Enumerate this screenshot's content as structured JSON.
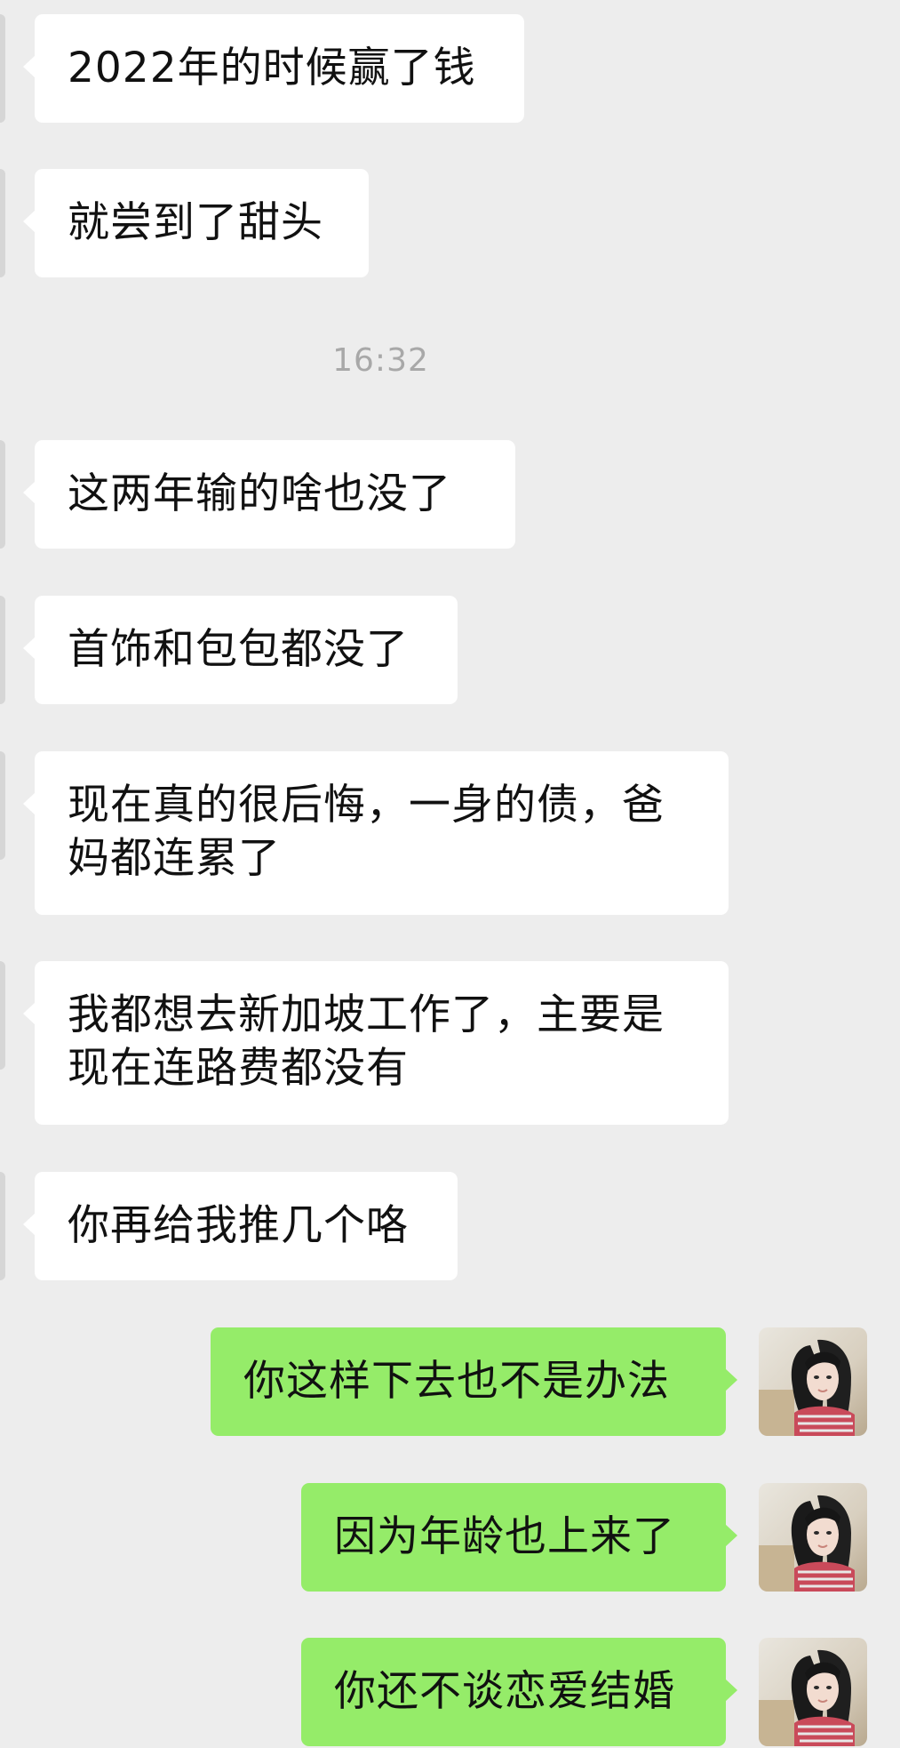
{
  "timestamp": "16:32",
  "messages": [
    {
      "side": "left",
      "text": "2022年的时候赢了钱"
    },
    {
      "side": "left",
      "text": "就尝到了甜头"
    },
    {
      "side": "left",
      "text": "这两年输的啥也没了"
    },
    {
      "side": "left",
      "text": "首饰和包包都没了"
    },
    {
      "side": "left",
      "text": "现在真的很后悔，一身的债，爸妈都连累了"
    },
    {
      "side": "left",
      "text": "我都想去新加坡工作了，主要是现在连路费都没有"
    },
    {
      "side": "left",
      "text": "你再给我推几个咯"
    },
    {
      "side": "right",
      "text": "你这样下去也不是办法"
    },
    {
      "side": "right",
      "text": "因为年龄也上来了"
    },
    {
      "side": "right",
      "text": "你还不谈恋爱结婚"
    }
  ],
  "colors": {
    "background": "#ededed",
    "left_bubble": "#ffffff",
    "right_bubble": "#95ec69",
    "timestamp": "#a8a8a8"
  },
  "icons": {
    "self_avatar": "user-avatar-icon"
  }
}
